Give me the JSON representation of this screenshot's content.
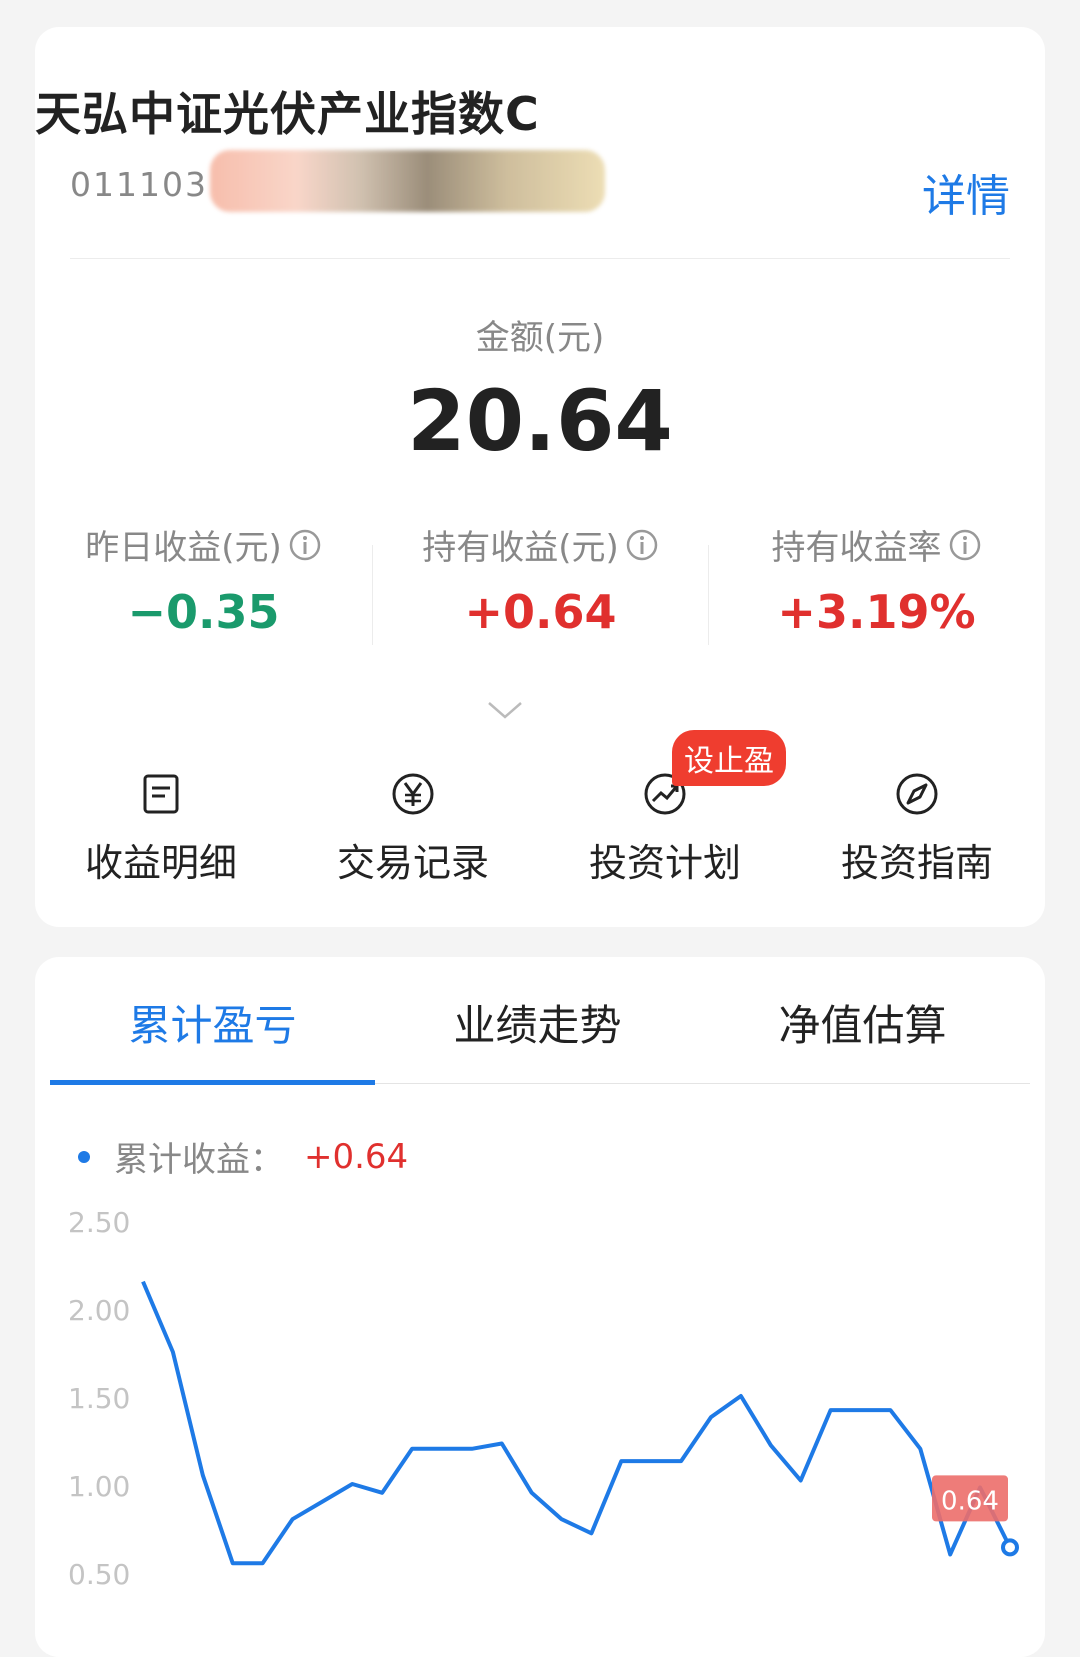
{
  "fund": {
    "name": "天弘中证光伏产业指数C",
    "code": "011103",
    "detail_label": "详情"
  },
  "amount": {
    "label": "金额(元)",
    "value": "20.64"
  },
  "stats": [
    {
      "label": "昨日收益(元)",
      "value": "−0.35",
      "color": "#1a9a6c"
    },
    {
      "label": "持有收益(元)",
      "value": "+0.64",
      "color": "#e0302e"
    },
    {
      "label": "持有收益率",
      "value": "+3.19%",
      "color": "#e0302e"
    }
  ],
  "actions": [
    {
      "label": "收益明细",
      "icon": "document-icon"
    },
    {
      "label": "交易记录",
      "icon": "yen-circle-icon"
    },
    {
      "label": "投资计划",
      "icon": "trend-up-icon",
      "badge": "设止盈"
    },
    {
      "label": "投资指南",
      "icon": "compass-icon"
    }
  ],
  "tabs": [
    {
      "label": "累计盈亏",
      "active": true
    },
    {
      "label": "业绩走势",
      "active": false
    },
    {
      "label": "净值估算",
      "active": false
    }
  ],
  "legend": {
    "label": "累计收益：",
    "value": "+0.64"
  },
  "colors": {
    "accent": "#1e7ae6",
    "gain": "#e0302e",
    "loss": "#1a9a6c"
  },
  "chart_data": {
    "type": "line",
    "y_ticks": [
      "2.50",
      "2.00",
      "1.50",
      "1.00",
      "0.50"
    ],
    "ylim": [
      0.5,
      2.5
    ],
    "grid": false,
    "series": [
      {
        "values": [
          2.15,
          1.75,
          1.05,
          0.55,
          0.55,
          0.8,
          0.9,
          1.0,
          0.95,
          1.2,
          1.2,
          1.2,
          1.23,
          0.95,
          0.8,
          0.72,
          1.13,
          1.13,
          1.13,
          1.38,
          1.5,
          1.22,
          1.02,
          1.42,
          1.42,
          1.42,
          1.2,
          0.6,
          0.98,
          0.64
        ]
      }
    ],
    "last_value_label": "0.64"
  }
}
